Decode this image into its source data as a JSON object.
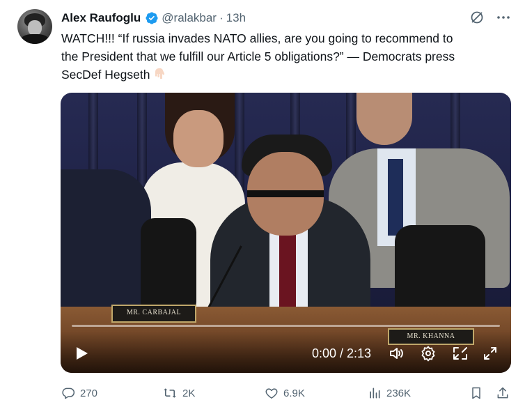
{
  "author": {
    "name": "Alex Raufoglu",
    "handle": "@ralakbar",
    "separator": "·",
    "time": "13h",
    "verified": true
  },
  "header_icons": [
    "grok-icon",
    "more-icon"
  ],
  "tweet": {
    "line1": "WATCH!!!  “If russia invades NATO allies, are you going to recommend to",
    "line2": "the President that we fulfill our Article 5 obligations?” — Democrats press",
    "line3": "SecDef Hegseth",
    "emoji": "backhand-index-pointing-down"
  },
  "video": {
    "nameplates": [
      "MR. CARBAJAL",
      "MR. KHANNA"
    ],
    "timecode": "0:00 / 2:13",
    "progress": 0,
    "controls": [
      "play-icon",
      "volume-icon",
      "settings-icon",
      "pip-icon",
      "fullscreen-icon"
    ]
  },
  "actions": {
    "replies": "270",
    "reposts": "2K",
    "likes": "6.9K",
    "views": "236K"
  },
  "colors": {
    "text": "#0f1419",
    "secondary": "#536471",
    "verified": "#1d9bf0"
  }
}
